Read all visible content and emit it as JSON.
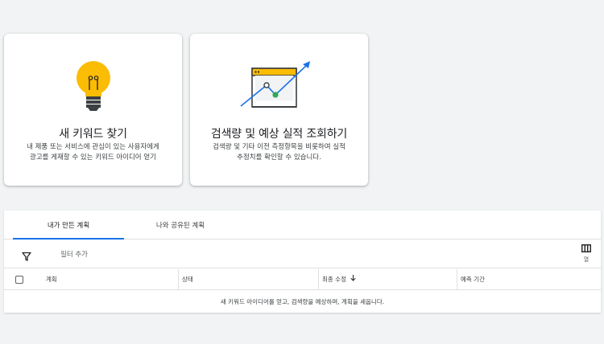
{
  "cards": [
    {
      "title": "새 키워드 찾기",
      "desc_line1": "내 제품 또는 서비스에 관심이 있는 사용자에게",
      "desc_line2": "광고를 게재할 수 있는 키워드 아이디어 얻기",
      "icon": "lightbulb-icon"
    },
    {
      "title": "검색량 및 예상 실적 조회하기",
      "desc_line1": "검색량 및 기타 이전 측정항목을 비롯하여 실적",
      "desc_line2": "추정치를 확인할 수 있습니다.",
      "icon": "trend-chart-icon"
    }
  ],
  "tabs": [
    {
      "label": "내가 만든 계획",
      "active": true
    },
    {
      "label": "나와 공유된 계획",
      "active": false
    }
  ],
  "filter": {
    "add_label": "필터 추가",
    "icon": "filter-icon"
  },
  "columns_button": {
    "label": "열",
    "icon": "columns-icon"
  },
  "table": {
    "headers": [
      "계획",
      "상태",
      "최종 수정",
      "예측 기간"
    ],
    "sort_column": "최종 수정",
    "sort_direction": "descending",
    "empty_message": "새 키워드 아이디어를 얻고, 검색량을 예상하며, 계획을 세웁니다."
  },
  "colors": {
    "accent": "#1a73e8",
    "bulb": "#fbbc04",
    "green": "#34a853",
    "dark": "#3c4043"
  }
}
